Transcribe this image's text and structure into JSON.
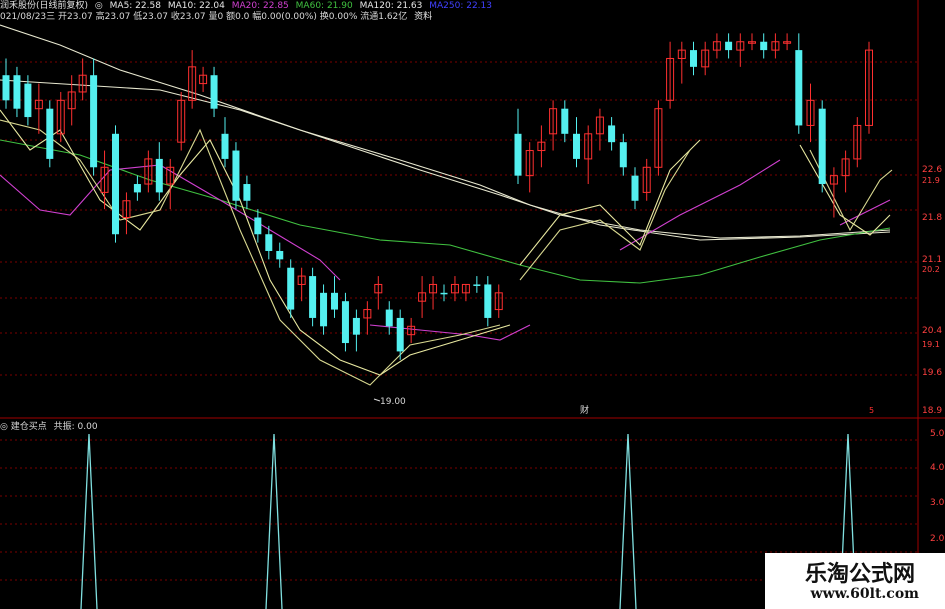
{
  "header": {
    "stock_name": "润禾股份(日线前复权)",
    "ma_items": [
      {
        "label": "MA5: 22.58",
        "color": "#e8e8e8"
      },
      {
        "label": "MA10: 22.04",
        "color": "#e8e8e8"
      },
      {
        "label": "MA20: 22.85",
        "color": "#d040d0"
      },
      {
        "label": "MA60: 21.90",
        "color": "#40c040"
      },
      {
        "label": "MA120: 21.63",
        "color": "#e8e8e8"
      },
      {
        "label": "MA250: 22.13",
        "color": "#4040ff"
      }
    ],
    "ohlc_line": "021/08/23三 开23.07 高23.07 低23.07 收23.07 量0 额0.0 幅0.00(0.00%) 换0.00% 流通1.62亿",
    "extra": "资料"
  },
  "main_chart": {
    "low_annotation": "19.00",
    "event_marker": "财",
    "event_marker2": "5",
    "price_labels": [
      "22.6",
      "21.8",
      "21.1",
      "20.4",
      "19.6",
      "18.9"
    ],
    "price_labels_small": [
      "21.9",
      "20.2",
      "19.1"
    ]
  },
  "indicator": {
    "title": "建仓买点",
    "value_label": "共振: 0.00",
    "axis_labels": [
      "5.0",
      "4.0",
      "3.0",
      "2.0"
    ]
  },
  "chart_data": {
    "type": "candlestick",
    "price_range": [
      18.9,
      23.5
    ],
    "candles": [
      {
        "o": 22.9,
        "h": 23.1,
        "l": 22.5,
        "c": 22.6,
        "dir": "down"
      },
      {
        "o": 22.9,
        "h": 23.0,
        "l": 22.4,
        "c": 22.5,
        "dir": "down"
      },
      {
        "o": 22.8,
        "h": 22.9,
        "l": 22.3,
        "c": 22.4,
        "dir": "down"
      },
      {
        "o": 22.5,
        "h": 22.8,
        "l": 22.2,
        "c": 22.6,
        "dir": "up"
      },
      {
        "o": 22.5,
        "h": 22.6,
        "l": 21.8,
        "c": 21.9,
        "dir": "down"
      },
      {
        "o": 22.2,
        "h": 22.7,
        "l": 22.1,
        "c": 22.6,
        "dir": "up"
      },
      {
        "o": 22.5,
        "h": 22.9,
        "l": 22.3,
        "c": 22.7,
        "dir": "up"
      },
      {
        "o": 22.7,
        "h": 23.1,
        "l": 22.6,
        "c": 22.9,
        "dir": "up"
      },
      {
        "o": 22.9,
        "h": 23.1,
        "l": 21.7,
        "c": 21.8,
        "dir": "down"
      },
      {
        "o": 21.8,
        "h": 22.0,
        "l": 21.3,
        "c": 21.5,
        "dir": "up"
      },
      {
        "o": 22.2,
        "h": 22.3,
        "l": 20.9,
        "c": 21.0,
        "dir": "down"
      },
      {
        "o": 21.2,
        "h": 21.5,
        "l": 21.0,
        "c": 21.4,
        "dir": "up"
      },
      {
        "o": 21.6,
        "h": 21.7,
        "l": 21.4,
        "c": 21.5,
        "dir": "down"
      },
      {
        "o": 21.6,
        "h": 22.0,
        "l": 21.5,
        "c": 21.9,
        "dir": "up"
      },
      {
        "o": 21.9,
        "h": 22.1,
        "l": 21.4,
        "c": 21.5,
        "dir": "down"
      },
      {
        "o": 21.6,
        "h": 21.9,
        "l": 21.3,
        "c": 21.8,
        "dir": "up"
      },
      {
        "o": 22.1,
        "h": 22.7,
        "l": 22.0,
        "c": 22.6,
        "dir": "up"
      },
      {
        "o": 22.6,
        "h": 23.2,
        "l": 22.5,
        "c": 23.0,
        "dir": "up"
      },
      {
        "o": 22.8,
        "h": 23.0,
        "l": 22.7,
        "c": 22.9,
        "dir": "up"
      },
      {
        "o": 22.9,
        "h": 23.0,
        "l": 22.4,
        "c": 22.5,
        "dir": "down"
      },
      {
        "o": 22.2,
        "h": 22.4,
        "l": 21.8,
        "c": 21.9,
        "dir": "down"
      },
      {
        "o": 22.0,
        "h": 22.1,
        "l": 21.3,
        "c": 21.4,
        "dir": "down"
      },
      {
        "o": 21.6,
        "h": 21.7,
        "l": 21.3,
        "c": 21.4,
        "dir": "down"
      },
      {
        "o": 21.2,
        "h": 21.3,
        "l": 20.9,
        "c": 21.0,
        "dir": "down"
      },
      {
        "o": 21.0,
        "h": 21.1,
        "l": 20.7,
        "c": 20.8,
        "dir": "down"
      },
      {
        "o": 20.8,
        "h": 20.9,
        "l": 20.6,
        "c": 20.7,
        "dir": "down"
      },
      {
        "o": 20.6,
        "h": 20.7,
        "l": 20.0,
        "c": 20.1,
        "dir": "down"
      },
      {
        "o": 20.4,
        "h": 20.6,
        "l": 20.2,
        "c": 20.5,
        "dir": "up"
      },
      {
        "o": 20.5,
        "h": 20.6,
        "l": 19.9,
        "c": 20.0,
        "dir": "down"
      },
      {
        "o": 20.3,
        "h": 20.4,
        "l": 19.8,
        "c": 19.9,
        "dir": "down"
      },
      {
        "o": 20.3,
        "h": 20.5,
        "l": 20.0,
        "c": 20.1,
        "dir": "down"
      },
      {
        "o": 20.2,
        "h": 20.3,
        "l": 19.6,
        "c": 19.7,
        "dir": "down"
      },
      {
        "o": 20.0,
        "h": 20.1,
        "l": 19.6,
        "c": 19.8,
        "dir": "down"
      },
      {
        "o": 20.0,
        "h": 20.2,
        "l": 19.8,
        "c": 20.1,
        "dir": "up"
      },
      {
        "o": 20.3,
        "h": 20.5,
        "l": 20.1,
        "c": 20.4,
        "dir": "up"
      },
      {
        "o": 20.1,
        "h": 20.2,
        "l": 19.8,
        "c": 19.9,
        "dir": "down"
      },
      {
        "o": 20.0,
        "h": 20.1,
        "l": 19.5,
        "c": 19.6,
        "dir": "down"
      },
      {
        "o": 19.8,
        "h": 20.0,
        "l": 19.7,
        "c": 19.9,
        "dir": "up"
      },
      {
        "o": 20.2,
        "h": 20.5,
        "l": 20.0,
        "c": 20.3,
        "dir": "up"
      },
      {
        "o": 20.3,
        "h": 20.5,
        "l": 20.1,
        "c": 20.4,
        "dir": "up"
      },
      {
        "o": 20.3,
        "h": 20.4,
        "l": 20.2,
        "c": 20.3,
        "dir": "down"
      },
      {
        "o": 20.3,
        "h": 20.5,
        "l": 20.2,
        "c": 20.4,
        "dir": "up"
      },
      {
        "o": 20.3,
        "h": 20.4,
        "l": 20.2,
        "c": 20.4,
        "dir": "up"
      },
      {
        "o": 20.4,
        "h": 20.5,
        "l": 20.3,
        "c": 20.4,
        "dir": "down"
      },
      {
        "o": 20.4,
        "h": 20.5,
        "l": 19.9,
        "c": 20.0,
        "dir": "down"
      },
      {
        "o": 20.1,
        "h": 20.4,
        "l": 20.0,
        "c": 20.3,
        "dir": "up"
      }
    ],
    "signals": [
      1,
      1,
      1,
      1
    ]
  }
}
